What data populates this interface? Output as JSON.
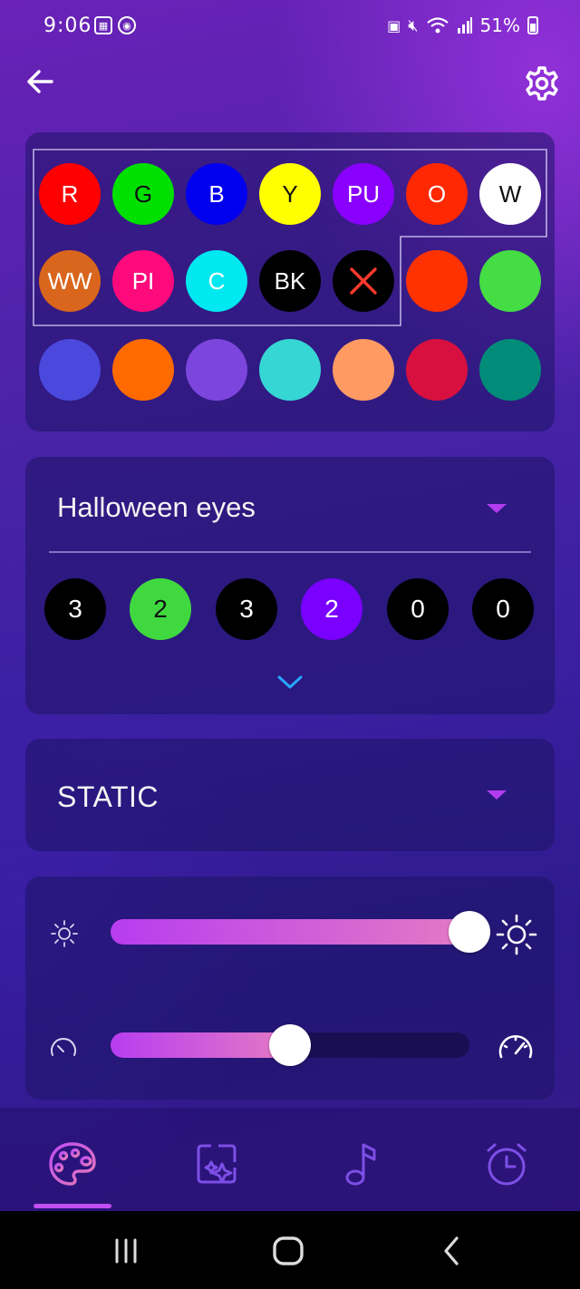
{
  "status_bar": {
    "time": "9:06",
    "battery_percent": "51%",
    "icons": [
      "gallery-icon",
      "shield-icon",
      "nfc-icon",
      "mute-icon",
      "wifi-icon",
      "signal-icon",
      "battery-icon"
    ]
  },
  "top_bar": {
    "back_icon": "arrow-left-icon",
    "settings_icon": "gear-icon"
  },
  "palette": {
    "swatches": [
      {
        "label": "R",
        "color": "#ff0000"
      },
      {
        "label": "G",
        "color": "#00e000"
      },
      {
        "label": "B",
        "color": "#0000ee"
      },
      {
        "label": "Y",
        "color": "#ffff00"
      },
      {
        "label": "PU",
        "color": "#8a00ff"
      },
      {
        "label": "O",
        "color": "#ff2800"
      },
      {
        "label": "W",
        "color": "#ffffff"
      },
      {
        "label": "WW",
        "color": "#d9661c"
      },
      {
        "label": "PI",
        "color": "#ff0a7c"
      },
      {
        "label": "C",
        "color": "#00e8f0"
      },
      {
        "label": "BK",
        "color": "#000000"
      },
      {
        "label": "",
        "color": "#000000",
        "icon": "x-icon"
      },
      {
        "label": "",
        "color": "#ff3200"
      },
      {
        "label": "",
        "color": "#44dd44"
      },
      {
        "label": "",
        "color": "#4a48dd"
      },
      {
        "label": "",
        "color": "#ff6a00"
      },
      {
        "label": "",
        "color": "#7c45dd"
      },
      {
        "label": "",
        "color": "#36d6d4"
      },
      {
        "label": "",
        "color": "#ff9a63"
      },
      {
        "label": "",
        "color": "#d8103f"
      },
      {
        "label": "",
        "color": "#008c78"
      }
    ]
  },
  "mode": {
    "title": "Halloween eyes",
    "counts": [
      {
        "value": "3",
        "color": "#000000"
      },
      {
        "value": "2",
        "color": "#3fd93f"
      },
      {
        "value": "3",
        "color": "#000000"
      },
      {
        "value": "2",
        "color": "#7a00ff"
      },
      {
        "value": "0",
        "color": "#000000"
      },
      {
        "value": "0",
        "color": "#000000"
      }
    ]
  },
  "effect": {
    "title": "STATIC"
  },
  "brightness": {
    "level": 1.0,
    "icon_low": "sun-small-icon",
    "icon_high": "sun-large-icon"
  },
  "speed": {
    "level": 0.5,
    "icon_low": "speedometer-slow-icon",
    "icon_high": "speedometer-fast-icon"
  },
  "colors": {
    "accent": "#c04ef2",
    "chevron": "#2aa4ff"
  },
  "bottom_nav": {
    "items": [
      "palette-icon",
      "sparkle-icon",
      "music-note-icon",
      "alarm-clock-icon"
    ],
    "active_index": 0
  }
}
